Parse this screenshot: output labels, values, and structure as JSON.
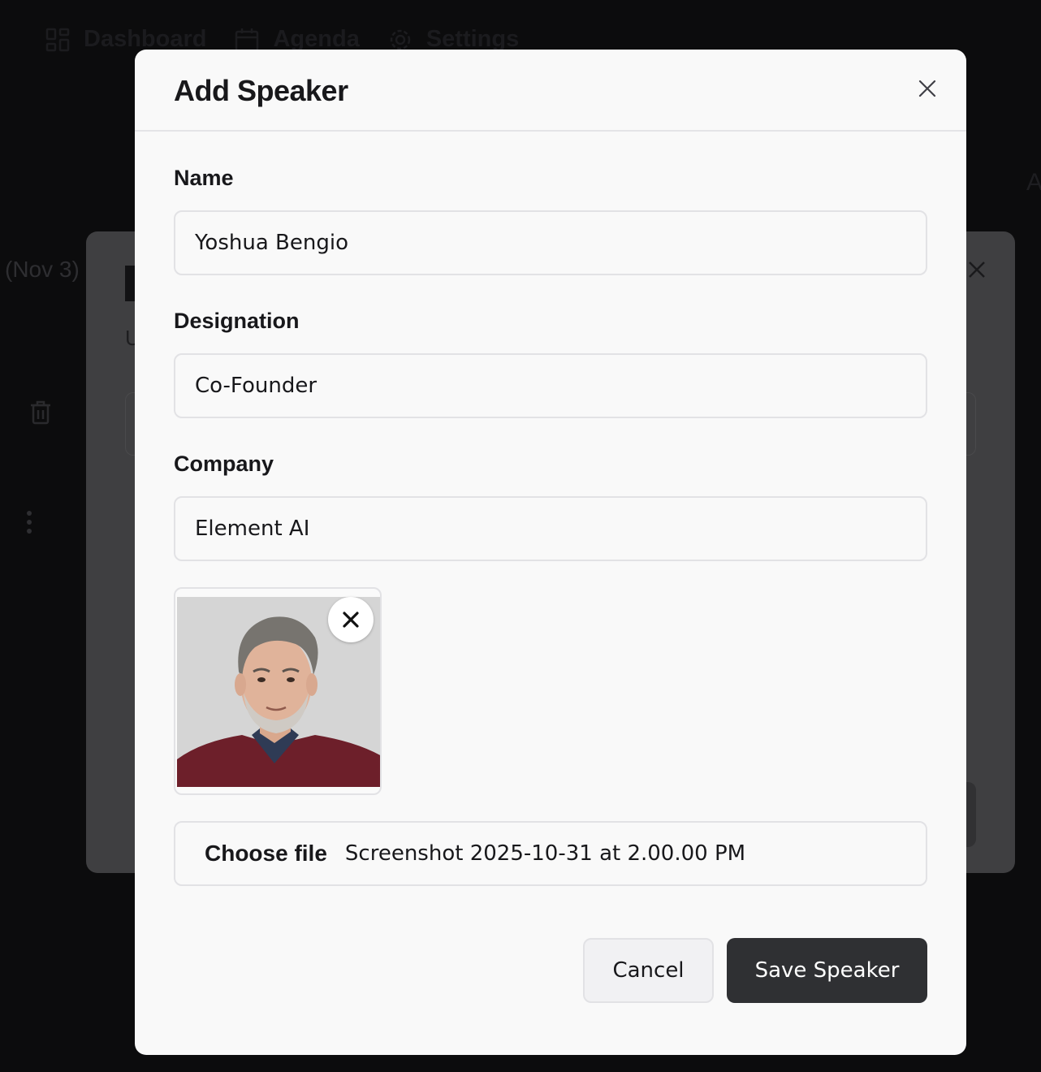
{
  "background": {
    "nav": [
      {
        "label": "Dashboard",
        "icon": "grid-icon"
      },
      {
        "label": "Agenda",
        "icon": "calendar-icon"
      },
      {
        "label": "Settings",
        "icon": "gear-icon"
      }
    ],
    "date_fragment": "(Nov 3)",
    "right_fragment": "A",
    "modal_letter_small": "U"
  },
  "modal": {
    "title": "Add Speaker",
    "close_icon": "close-icon",
    "fields": {
      "name": {
        "label": "Name",
        "value": "Yoshua Bengio"
      },
      "designation": {
        "label": "Designation",
        "value": "Co-Founder"
      },
      "company": {
        "label": "Company",
        "value": "Element AI"
      }
    },
    "photo": {
      "remove_icon": "close-icon"
    },
    "file_input": {
      "button_label": "Choose file",
      "file_name": "Screenshot 2025-10-31 at 2.00.00 PM"
    },
    "actions": {
      "cancel_label": "Cancel",
      "save_label": "Save Speaker"
    }
  },
  "colors": {
    "overlay": "#0c0c0d",
    "modal_bg": "#f9f9f9",
    "primary_button": "#2f3033",
    "border": "#e2e2e5"
  }
}
